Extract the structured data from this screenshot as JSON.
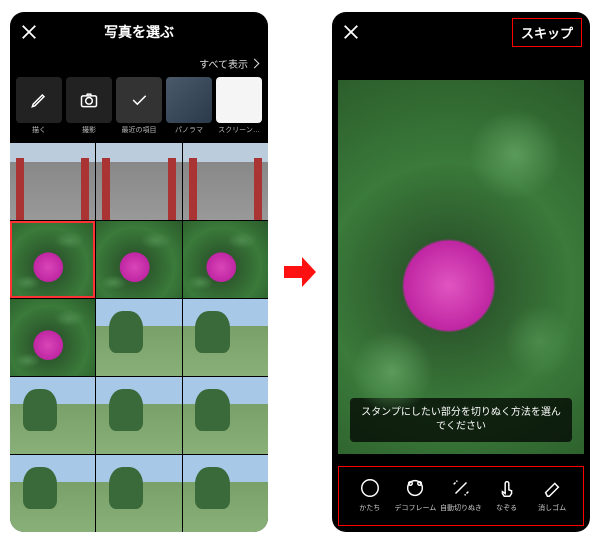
{
  "left": {
    "title": "写真を選ぶ",
    "show_all": "すべて表示",
    "sources": [
      {
        "id": "draw",
        "label": "描く"
      },
      {
        "id": "camera",
        "label": "撮影"
      },
      {
        "id": "recent",
        "label": "最近の項目",
        "selected": true
      },
      {
        "id": "panorama",
        "label": "パノラマ"
      },
      {
        "id": "screenshot",
        "label": "スクリーン…"
      }
    ],
    "grid_selected_index": 3
  },
  "right": {
    "skip": "スキップ",
    "tip": "スタンプにしたい部分を切りぬく方法を選んでください",
    "tools": [
      {
        "id": "shape",
        "label": "かたち"
      },
      {
        "id": "decoframe",
        "label": "デコフレーム"
      },
      {
        "id": "autocut",
        "label": "自動切りぬき"
      },
      {
        "id": "trace",
        "label": "なぞる"
      },
      {
        "id": "eraser",
        "label": "消しゴム"
      }
    ]
  }
}
